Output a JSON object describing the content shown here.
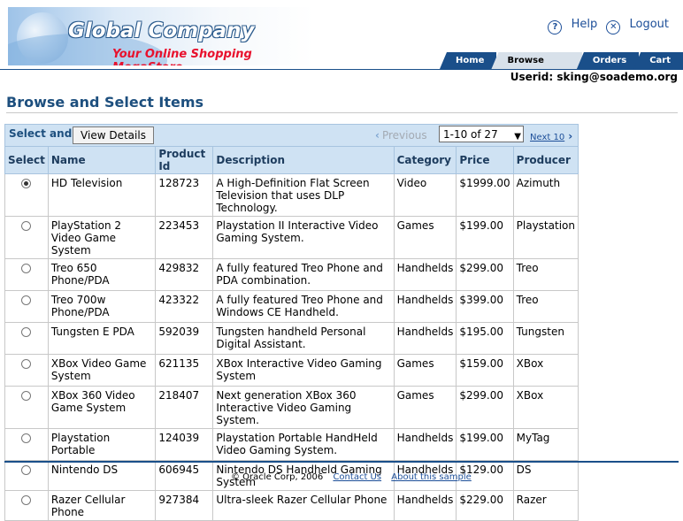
{
  "brand": {
    "title": "Global Company",
    "subtitle": "Your Online Shopping MegaStore"
  },
  "top_links": {
    "help": "Help",
    "logout": "Logout"
  },
  "tabs": [
    {
      "label": "Home"
    },
    {
      "label": "Browse Items"
    },
    {
      "label": "Orders"
    },
    {
      "label": "Cart"
    }
  ],
  "userid": "Userid: sking@soademo.org",
  "page_title": "Browse and Select Items",
  "toolbar": {
    "select_label": "Select and",
    "view_details": "View Details",
    "previous": "Previous",
    "range": "1-10 of 27",
    "next": "Next 10"
  },
  "columns": [
    "Select",
    "Name",
    "Product Id",
    "Description",
    "Category",
    "Price",
    "Producer"
  ],
  "rows": [
    {
      "selected": true,
      "name": "HD Television",
      "id": "128723",
      "desc": "A High-Definition Flat Screen Television that uses DLP Technology.",
      "category": "Video",
      "price": "$1999.00",
      "producer": "Azimuth"
    },
    {
      "selected": false,
      "name": "PlayStation 2 Video Game System",
      "id": "223453",
      "desc": "Playstation II Interactive Video Gaming System.",
      "category": "Games",
      "price": "$199.00",
      "producer": "Playstation"
    },
    {
      "selected": false,
      "name": "Treo 650 Phone/PDA",
      "id": "429832",
      "desc": "A fully featured Treo Phone and PDA combination.",
      "category": "Handhelds",
      "price": "$299.00",
      "producer": "Treo"
    },
    {
      "selected": false,
      "name": "Treo 700w Phone/PDA",
      "id": "423322",
      "desc": "A fully featured Treo Phone and Windows CE Handheld.",
      "category": "Handhelds",
      "price": "$399.00",
      "producer": "Treo"
    },
    {
      "selected": false,
      "name": "Tungsten E PDA",
      "id": "592039",
      "desc": "Tungsten handheld Personal Digital Assistant.",
      "category": "Handhelds",
      "price": "$195.00",
      "producer": "Tungsten"
    },
    {
      "selected": false,
      "name": "XBox Video Game System",
      "id": "621135",
      "desc": "XBox Interactive Video Gaming System",
      "category": "Games",
      "price": "$159.00",
      "producer": "XBox"
    },
    {
      "selected": false,
      "name": "XBox 360 Video Game System",
      "id": "218407",
      "desc": "Next generation XBox 360 Interactive Video Gaming System.",
      "category": "Games",
      "price": "$299.00",
      "producer": "XBox"
    },
    {
      "selected": false,
      "name": "Playstation Portable",
      "id": "124039",
      "desc": "Playstation Portable HandHeld Video Gaming System.",
      "category": "Handhelds",
      "price": "$199.00",
      "producer": "MyTag"
    },
    {
      "selected": false,
      "name": "Nintendo DS",
      "id": "606945",
      "desc": "Nintendo DS Handheld Gaming System",
      "category": "Handhelds",
      "price": "$129.00",
      "producer": "DS"
    },
    {
      "selected": false,
      "name": "Razer Cellular Phone",
      "id": "927384",
      "desc": "Ultra-sleek Razer Cellular Phone",
      "category": "Handhelds",
      "price": "$229.00",
      "producer": "Razer"
    }
  ],
  "footer": {
    "copyright": "© Oracle Corp, 2006",
    "contact": "Contact Us",
    "about": "About this sample"
  }
}
